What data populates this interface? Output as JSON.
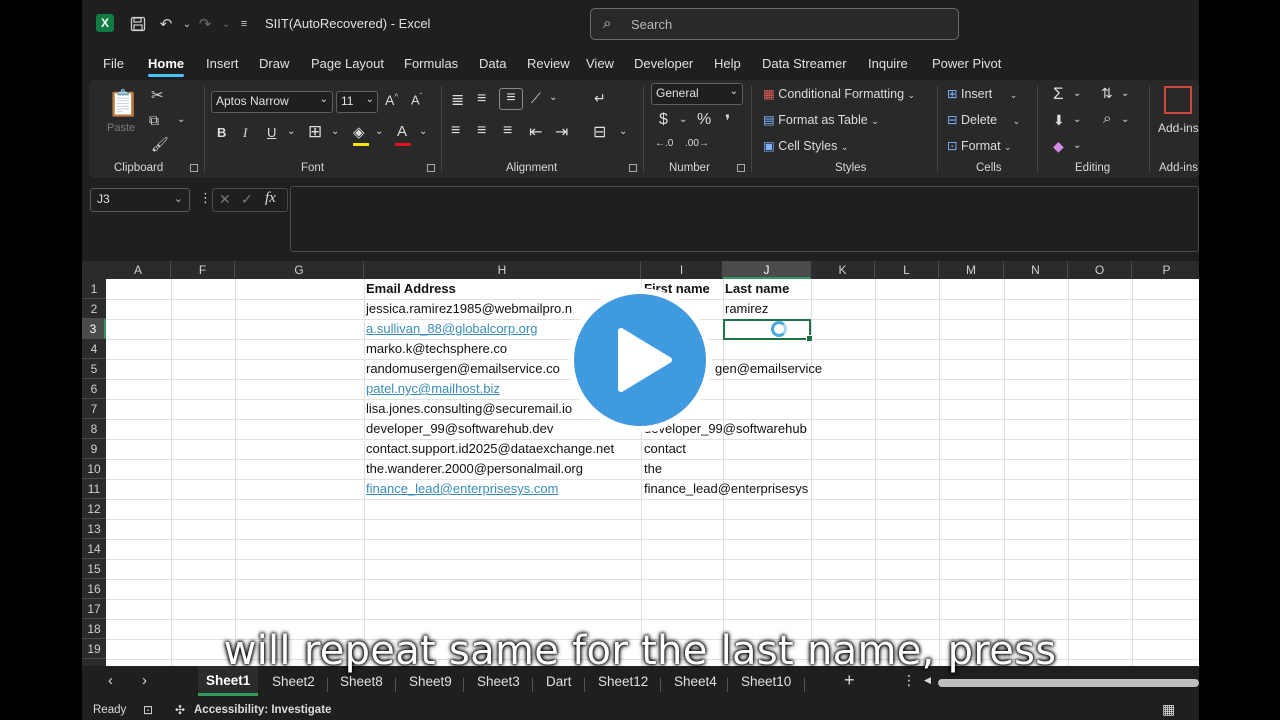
{
  "window": {
    "app_icon": "X",
    "title": "SIIT(AutoRecovered)  -  Excel",
    "search_placeholder": "Search"
  },
  "menu_tabs": [
    "File",
    "Home",
    "Insert",
    "Draw",
    "Page Layout",
    "Formulas",
    "Data",
    "Review",
    "View",
    "Developer",
    "Help",
    "Data Streamer",
    "Inquire",
    "Power Pivot"
  ],
  "active_menu_tab": "Home",
  "ribbon": {
    "clipboard": {
      "label": "Clipboard",
      "paste": "Paste"
    },
    "font": {
      "label": "Font",
      "font_name": "Aptos Narrow",
      "font_size": "11"
    },
    "alignment": {
      "label": "Alignment"
    },
    "number": {
      "label": "Number",
      "format": "General"
    },
    "styles": {
      "label": "Styles",
      "conditional": "Conditional Formatting",
      "format_table": "Format as Table",
      "cell_styles": "Cell Styles"
    },
    "cells": {
      "label": "Cells",
      "insert": "Insert",
      "delete": "Delete",
      "format": "Format"
    },
    "editing": {
      "label": "Editing"
    },
    "addins": {
      "label": "Add-ins",
      "button": "Add-ins"
    }
  },
  "formula_bar": {
    "name_box": "J3",
    "fx": "fx",
    "value": ""
  },
  "columns": [
    "A",
    "F",
    "G",
    "H",
    "I",
    "J",
    "K",
    "L",
    "M",
    "N",
    "O",
    "P"
  ],
  "selected_column": "J",
  "rows": [
    "1",
    "2",
    "3",
    "4",
    "5",
    "6",
    "7",
    "8",
    "9",
    "10",
    "11",
    "12",
    "13",
    "14",
    "15",
    "16",
    "17",
    "18",
    "19"
  ],
  "selected_row": "3",
  "cells": {
    "H1": "Email Address",
    "I1": "First name",
    "J1": "Last name",
    "H2": "jessica.ramirez1985@webmailpro.n",
    "J2": "ramirez",
    "H3": "a.sullivan_88@globalcorp.org",
    "H4": "marko.k@techsphere.co",
    "H5": "randomusergen@emailservice.co",
    "I5": "gen@emailservice",
    "H6": "patel.nyc@mailhost.biz",
    "H7": "lisa.jones.consulting@securemail.io",
    "H8": "developer_99@softwarehub.dev",
    "I8": "developer_99@softwarehub",
    "H9": "contact.support.id2025@dataexchange.net",
    "I9": "contact",
    "H10": "the.wanderer.2000@personalmail.org",
    "I10": "the",
    "H11": "finance_lead@enterprisesys.com",
    "I11": "finance_lead@enterprisesys"
  },
  "sheets": [
    "Sheet1",
    "Sheet2",
    "Sheet8",
    "Sheet9",
    "Sheet3",
    "Dart",
    "Sheet12",
    "Sheet4",
    "Sheet10"
  ],
  "active_sheet": "Sheet1",
  "status": {
    "ready": "Ready",
    "accessibility": "Accessibility: Investigate"
  },
  "caption": "will repeat same for the last name, press",
  "colors": {
    "accent": "#4cc2ff",
    "excel_green": "#107c41",
    "play": "#3f9ae0",
    "link": "#3a8cba"
  }
}
